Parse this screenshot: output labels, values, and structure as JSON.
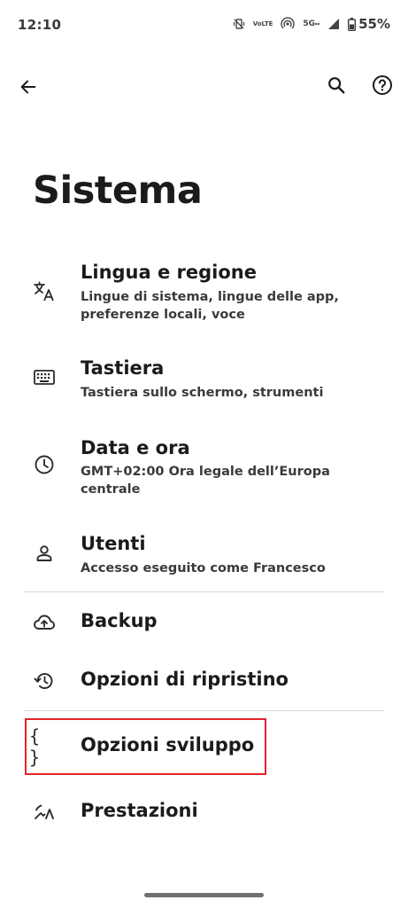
{
  "status": {
    "time": "12:10",
    "volte_top": "Vo",
    "volte_bottom": "LTE",
    "network": "5G",
    "battery": "55%"
  },
  "appbar": {
    "back_icon": "arrow-back-icon",
    "search_icon": "search-icon",
    "help_icon": "help-icon"
  },
  "page": {
    "title": "Sistema"
  },
  "items": [
    {
      "title": "Lingua e regione",
      "subtitle": "Lingue di sistema, lingue delle app, preferenze locali, voce",
      "icon": "translate-icon"
    },
    {
      "title": "Tastiera",
      "subtitle": "Tastiera sullo schermo, strumenti",
      "icon": "keyboard-icon"
    },
    {
      "title": "Data e ora",
      "subtitle": "GMT+02:00 Ora legale dell’Europa centrale",
      "icon": "clock-icon"
    },
    {
      "title": "Utenti",
      "subtitle": "Accesso eseguito come Francesco",
      "icon": "person-icon"
    },
    {
      "title": "Backup",
      "icon": "cloud-upload-icon"
    },
    {
      "title": "Opzioni di ripristino",
      "icon": "history-icon"
    },
    {
      "title": "Opzioni sviluppo",
      "icon": "braces-icon",
      "highlight_color": "#e0242a"
    },
    {
      "title": "Prestazioni",
      "icon": "performance-icon"
    }
  ]
}
